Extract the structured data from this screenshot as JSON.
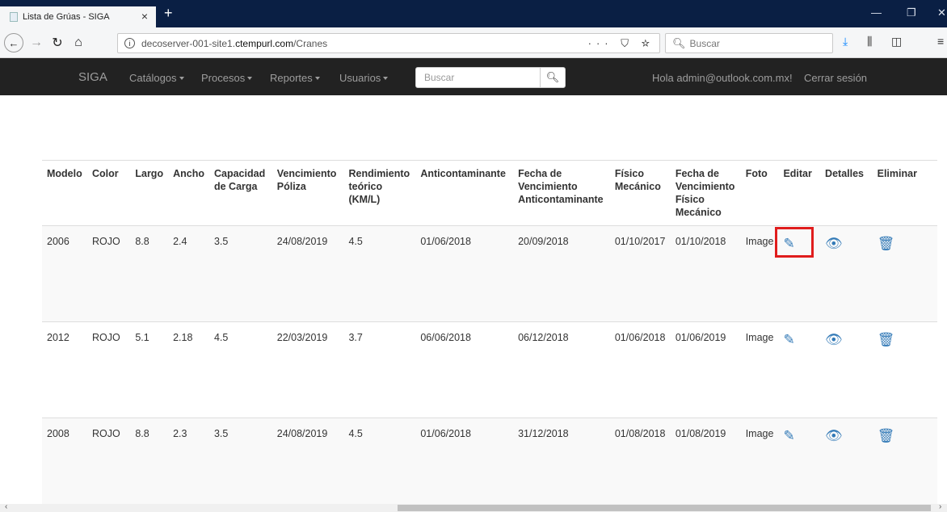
{
  "browser": {
    "tab_title": "Lista de Grúas - SIGA",
    "tab_close": "×",
    "new_tab": "+",
    "url_host": "decoserver-001-site1.",
    "url_domain": "ctempurl.com",
    "url_path": "/Cranes",
    "search_placeholder": "Buscar",
    "url_actions": "··· ⛉ ☆"
  },
  "site": {
    "brand": "SIGA",
    "menus": [
      "Catálogos",
      "Procesos",
      "Reportes",
      "Usuarios"
    ],
    "search_placeholder": "Buscar",
    "greeting": "Hola admin@outlook.com.mx!",
    "logout": "Cerrar sesión"
  },
  "table": {
    "headers": [
      "Modelo",
      "Color",
      "Largo",
      "Ancho",
      "Capacidad de Carga",
      "Vencimiento Póliza",
      "Rendimiento teórico (KM/L)",
      "Anticontaminante",
      "Fecha de Vencimiento Anticontaminante",
      "Físico Mecánico",
      "Fecha de Vencimiento Físico Mecánico",
      "Foto",
      "Editar",
      "Detalles",
      "Eliminar"
    ],
    "rows": [
      {
        "modelo": "2006",
        "color": "ROJO",
        "largo": "8.8",
        "ancho": "2.4",
        "capacidad": "3.5",
        "venc_poliza": "24/08/2019",
        "rendimiento": "4.5",
        "anticontaminante": "01/06/2018",
        "fecha_venc_anti": "20/09/2018",
        "fisico": "01/10/2017",
        "fecha_venc_fisico": "01/10/2018",
        "foto": "Image"
      },
      {
        "modelo": "2012",
        "color": "ROJO",
        "largo": "5.1",
        "ancho": "2.18",
        "capacidad": "4.5",
        "venc_poliza": "22/03/2019",
        "rendimiento": "3.7",
        "anticontaminante": "06/06/2018",
        "fecha_venc_anti": "06/12/2018",
        "fisico": "01/06/2018",
        "fecha_venc_fisico": "01/06/2019",
        "foto": "Image"
      },
      {
        "modelo": "2008",
        "color": "ROJO",
        "largo": "8.8",
        "ancho": "2.3",
        "capacidad": "3.5",
        "venc_poliza": "24/08/2019",
        "rendimiento": "4.5",
        "anticontaminante": "01/06/2018",
        "fecha_venc_anti": "31/12/2018",
        "fisico": "01/08/2018",
        "fecha_venc_fisico": "01/08/2019",
        "foto": "Image"
      }
    ]
  },
  "colors": {
    "link": "#337ab7",
    "highlight": "#e01d1d",
    "navbar": "#222222",
    "tabbar": "#0a1f44"
  }
}
